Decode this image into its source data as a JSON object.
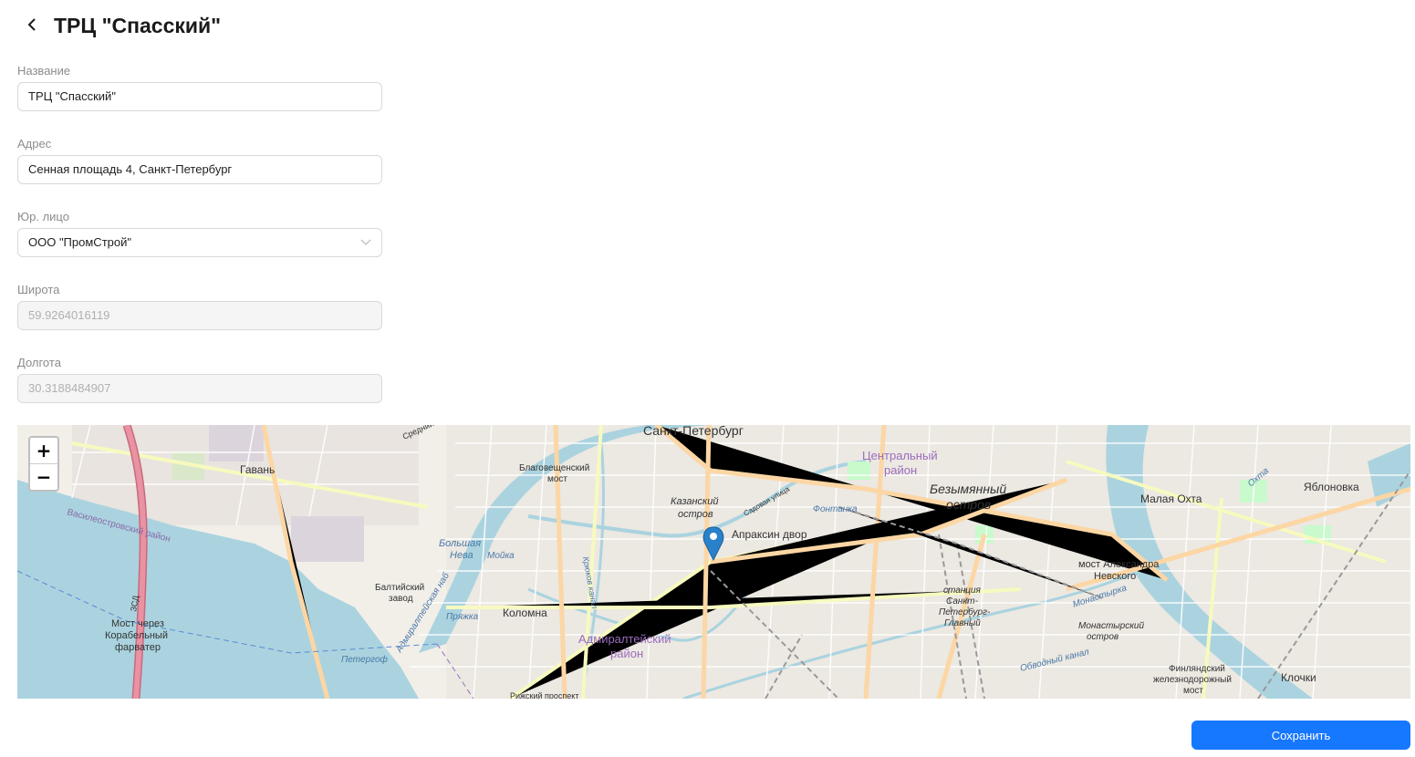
{
  "header": {
    "title": "ТРЦ \"Спасский\""
  },
  "form": {
    "name": {
      "label": "Название",
      "value": "ТРЦ \"Спасский\""
    },
    "address": {
      "label": "Адрес",
      "value": "Сенная площадь 4, Санкт-Петербург"
    },
    "legal_entity": {
      "label": "Юр. лицо",
      "value": "ООО \"ПромСтрой\""
    },
    "latitude": {
      "label": "Широта",
      "value": "59.9264016119"
    },
    "longitude": {
      "label": "Долгота",
      "value": "30.3188484907"
    }
  },
  "map": {
    "zoom_in": "+",
    "zoom_out": "−",
    "labels": {
      "city": "Санкт-Петербург",
      "gavan": "Гавань",
      "vasileostrovsky": "Василеостровский район",
      "blagoveshchensky_1": "Благовещенский",
      "blagoveshchensky_2": "мост",
      "kazansky_1": "Казанский",
      "kazansky_2": "остров",
      "apraksin": "Апраксин двор",
      "central_1": "Центральный",
      "central_2": "район",
      "bezymyanny_1": "Безымянный",
      "bezymyanny_2": "остров",
      "malaya_okhta": "Малая Охта",
      "yablonovka": "Яблоновка",
      "bolshaya_neva_1": "Большая",
      "bolshaya_neva_2": "Нева",
      "moyka": "Мойка",
      "baltic_1": "Балтийский",
      "baltic_2": "завод",
      "kolomna": "Коломна",
      "admiralteysky_1": "Адмиралтейский",
      "admiralteysky_2": "район",
      "most_1": "Мост через",
      "most_2": "Корабельный",
      "most_3": "фарватер",
      "petergof": "Петергоф",
      "admiralteyskaya_nab": "Адмиралтейская наб",
      "pryazhka": "Пряжка",
      "fontanka": "Фонтанка",
      "nevsky_most_1": "мост Александра",
      "nevsky_most_2": "Невского",
      "station_1": "станция",
      "station_2": "Санкт-",
      "station_3": "Петербург-",
      "station_4": "Главный",
      "monastyrsky_1": "Монастырский",
      "monastyrsky_2": "остров",
      "finlyandsky_1": "Финляндский",
      "finlyandsky_2": "железнодорожный",
      "finlyandsky_3": "мост",
      "klochki": "Клочки",
      "obvodny": "Обводный канал",
      "monastyrka": "Монастырка",
      "kryukov": "Крюков канал",
      "okhta": "Охта",
      "zsd": "ЗСД",
      "srednii": "Средний",
      "rizhsky": "Рижский проспект",
      "sadovaya": "Садовая улица"
    },
    "colors": {
      "water": "#aad3df",
      "land": "#f2efe9",
      "highway": "#e892a2",
      "primary": "#fcd6a4",
      "secondary": "#f7fabf",
      "marker": "#2a81cb"
    }
  },
  "footer": {
    "save_label": "Сохранить"
  }
}
